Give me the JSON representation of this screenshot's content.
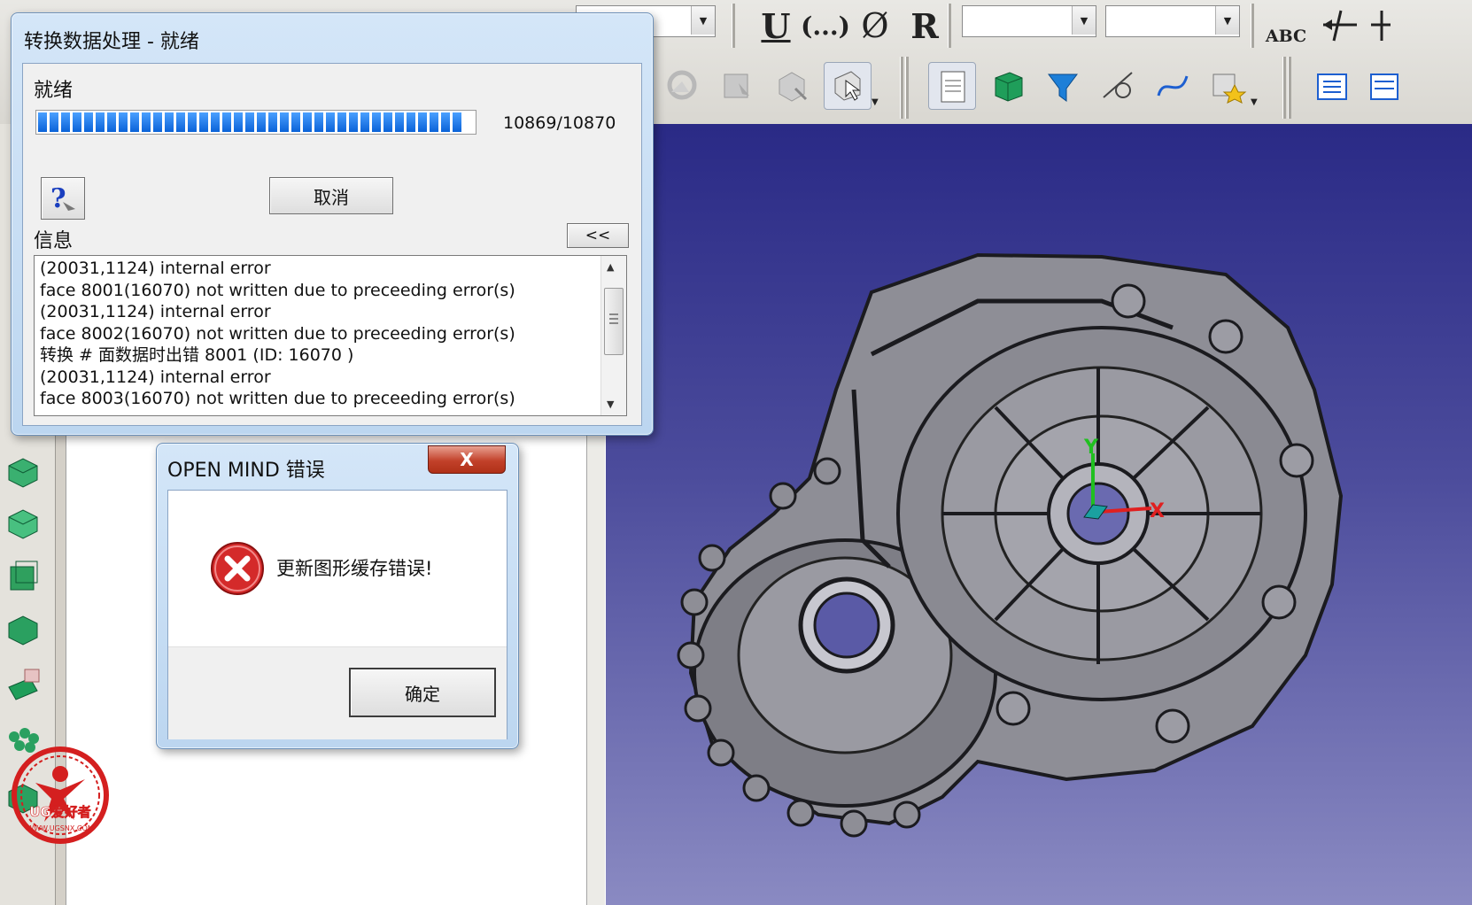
{
  "progress_dialog": {
    "title": "转换数据处理 - 就绪",
    "status": "就绪",
    "count": "10869/10870",
    "progress_fraction": 0.9999,
    "cancel_label": "取消",
    "help_icon": "help-question-icon",
    "info_label": "信息",
    "collapse_label": "<<",
    "log": [
      "(20031,1124) internal error",
      "face 8001(16070) not written due to preceeding error(s)",
      "(20031,1124) internal error",
      "face 8002(16070) not written due to preceeding error(s)",
      "转换 # 面数据时出错 8001 (ID: 16070 )",
      "(20031,1124) internal error",
      "face 8003(16070) not written due to preceeding error(s)"
    ]
  },
  "error_dialog": {
    "title": "OPEN MIND 错误",
    "message": "更新图形缓存错误!",
    "ok_label": "确定",
    "close_label": "X",
    "icon": "error-icon"
  },
  "toolbar": {
    "format_buttons": [
      "U",
      "(...)",
      "Ø",
      "R"
    ],
    "abc_label": "ABC"
  },
  "viewport": {
    "axis_labels": {
      "x": "X",
      "y": "Y"
    },
    "colors": {
      "background_top": "#2a2a86",
      "background_bottom": "#8a8ac2",
      "part": "#8e8e96",
      "axis_x": "#e02020",
      "axis_y": "#20c020"
    }
  },
  "watermark": {
    "text": "UG爱好者",
    "url": "WWW.UGSNX.COM"
  }
}
